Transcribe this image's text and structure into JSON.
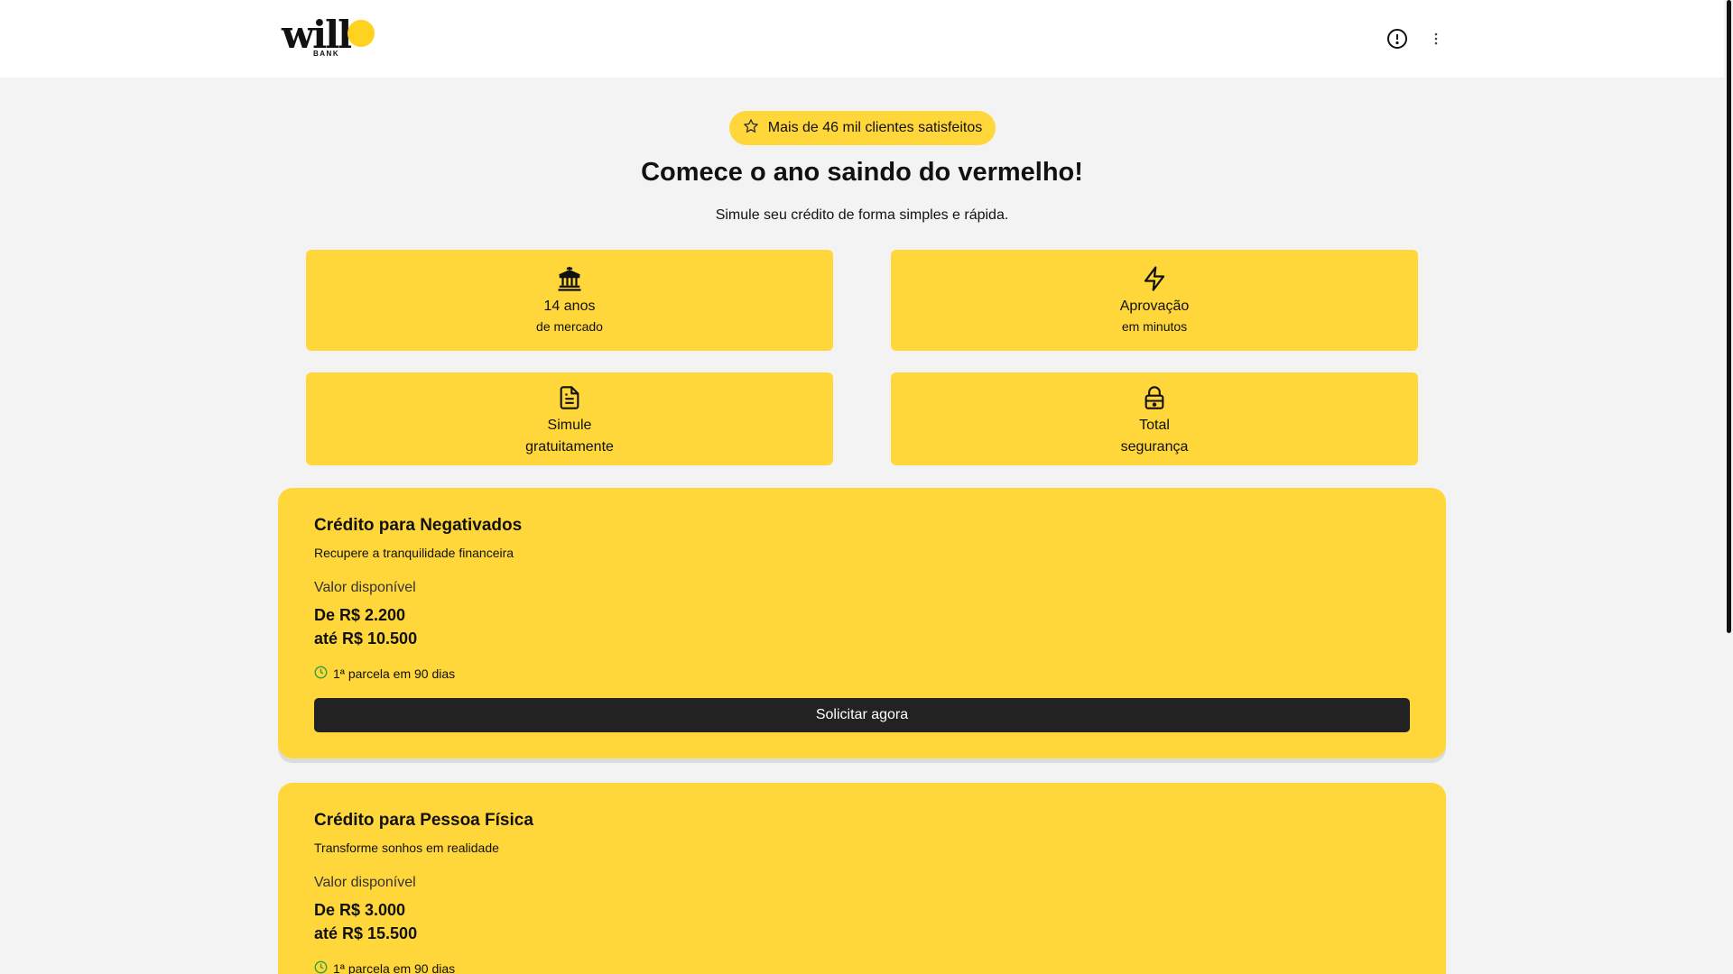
{
  "header": {
    "logo_text": "will",
    "logo_sub": "BANK",
    "info_icon": "alert-circle-icon",
    "menu_icon": "more-vertical-icon"
  },
  "hero": {
    "badge_icon": "star-icon",
    "badge_text": "Mais de 46 mil clientes satisfeitos",
    "title": "Comece o ano saindo do vermelho!",
    "subtitle": "Simule seu crédito de forma simples e rápida."
  },
  "features": [
    {
      "icon": "bank-icon",
      "line1": "14 anos",
      "line2": "de mercado"
    },
    {
      "icon": "lightning-icon",
      "line1": "Aprovação",
      "line2": "em minutos"
    },
    {
      "icon": "document-icon",
      "line1": "Simule",
      "line2": "gratuitamente"
    },
    {
      "icon": "lock-icon",
      "line1": "Total",
      "line2": "segurança"
    }
  ],
  "offers": [
    {
      "title": "Crédito para Negativados",
      "subtitle": "Recupere a tranquilidade financeira",
      "label": "Valor disponível",
      "min": "De R$ 2.200",
      "max": "até R$ 10.500",
      "note": "1ª parcela em 90 dias",
      "cta": "Solicitar agora"
    },
    {
      "title": "Crédito para Pessoa Física",
      "subtitle": "Transforme sonhos em realidade",
      "label": "Valor disponível",
      "min": "De R$ 3.000",
      "max": "até R$ 15.500",
      "note": "1ª parcela em 90 dias"
    }
  ],
  "colors": {
    "accent": "#ffd73a",
    "button": "#222222",
    "note_icon": "#2e9e3f"
  }
}
